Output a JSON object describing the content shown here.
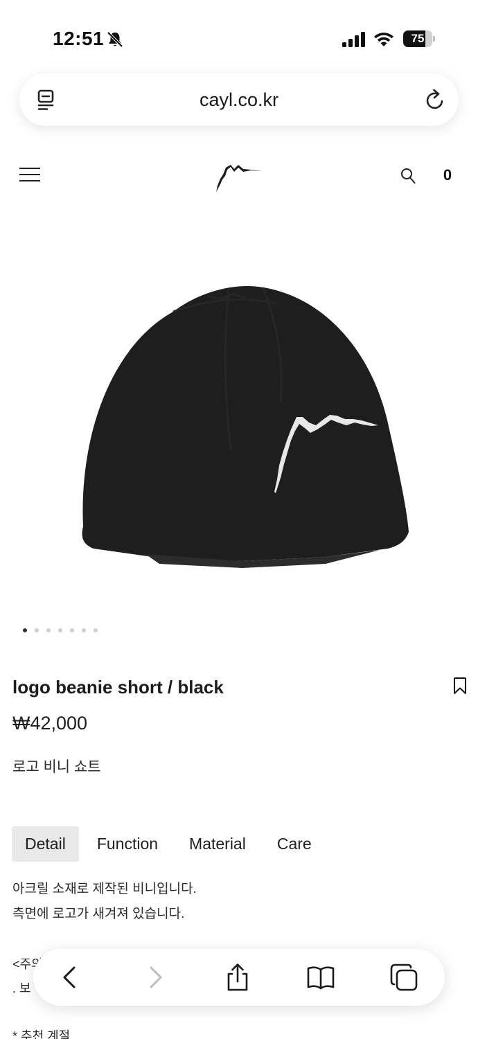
{
  "status_bar": {
    "time": "12:51",
    "battery": "75",
    "battery_level": 0.75
  },
  "browser": {
    "url": "cayl.co.kr"
  },
  "header": {
    "cart_count": "0"
  },
  "gallery": {
    "total_images": 7,
    "active_index": 0
  },
  "product": {
    "title": "logo beanie short / black",
    "price": "₩42,000",
    "subtitle": "로고 비니 쇼트"
  },
  "tabs": [
    {
      "label": "Detail",
      "active": true
    },
    {
      "label": "Function",
      "active": false
    },
    {
      "label": "Material",
      "active": false
    },
    {
      "label": "Care",
      "active": false
    }
  ],
  "detail": {
    "line1": "아크릴 소재로 제작된 비니입니다.",
    "line2": "측면에 로고가 새겨져 있습니다.",
    "note_heading": "<주의",
    "note_item": ". 보",
    "recommend": "* 추천 계절"
  },
  "colors": {
    "beanie": "#1e1e1e",
    "accent": "#111111",
    "tab_active_bg": "#e9e9e9"
  },
  "icons": [
    "bell-slash-icon",
    "signal-icon",
    "wifi-icon",
    "reader-icon",
    "reload-icon",
    "menu-icon",
    "search-icon",
    "bookmark-icon",
    "back-icon",
    "forward-icon",
    "share-icon",
    "bookmarks-icon",
    "tabs-icon"
  ]
}
